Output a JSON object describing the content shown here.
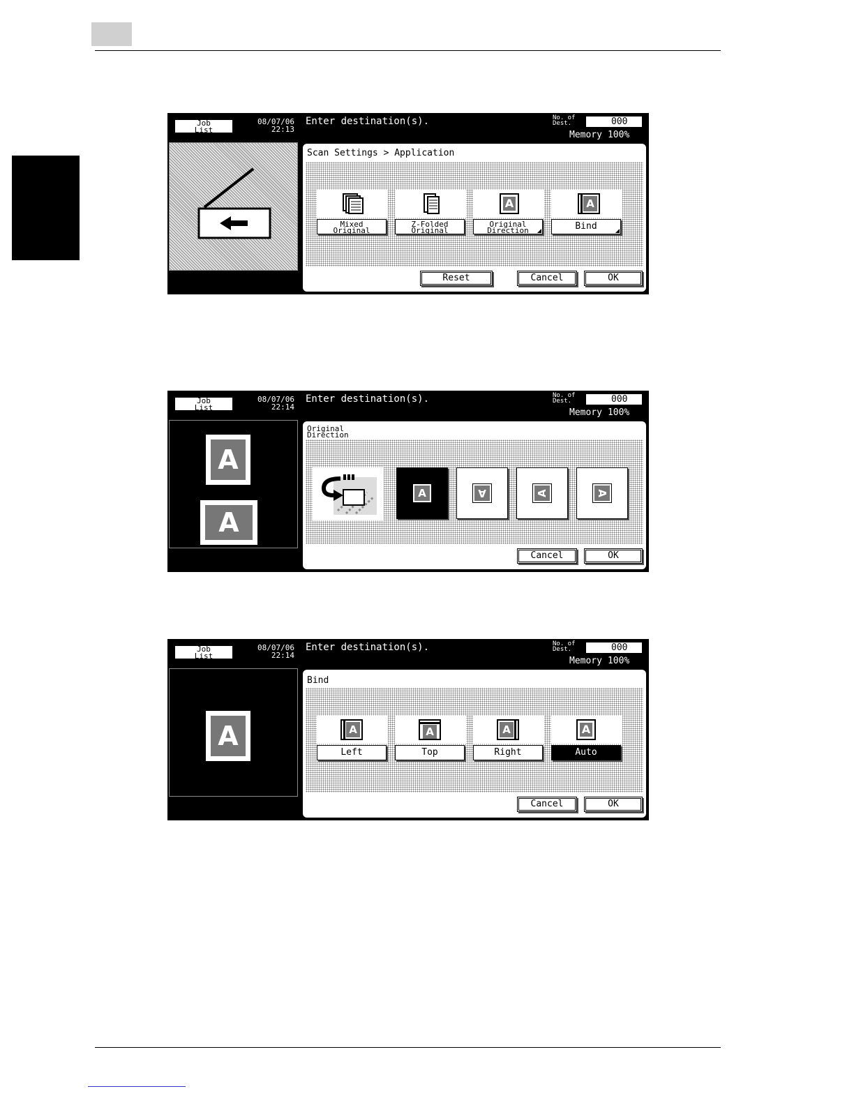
{
  "common": {
    "job_list_label": "Job\nList",
    "message": "Enter destination(s).",
    "dest_label": "No. of\nDest.",
    "dest_value": "000",
    "memory_label": "Memory",
    "memory_value": "100%",
    "cancel_label": "Cancel",
    "ok_label": "OK"
  },
  "screen1": {
    "datetime": "08/07/06\n22:13",
    "title": "Scan Settings > Application",
    "buttons": [
      "Mixed\nOriginal",
      "Z-Folded\nOriginal",
      "Original\nDirection",
      "Bind"
    ],
    "reset_label": "Reset"
  },
  "screen2": {
    "datetime": "08/07/06\n22:14",
    "title": "Original\nDirection",
    "glyph": "A"
  },
  "screen3": {
    "datetime": "08/07/06\n22:14",
    "title": "Bind",
    "buttons": [
      "Left",
      "Top",
      "Right",
      "Auto"
    ],
    "selected": "Auto",
    "glyph": "A"
  }
}
